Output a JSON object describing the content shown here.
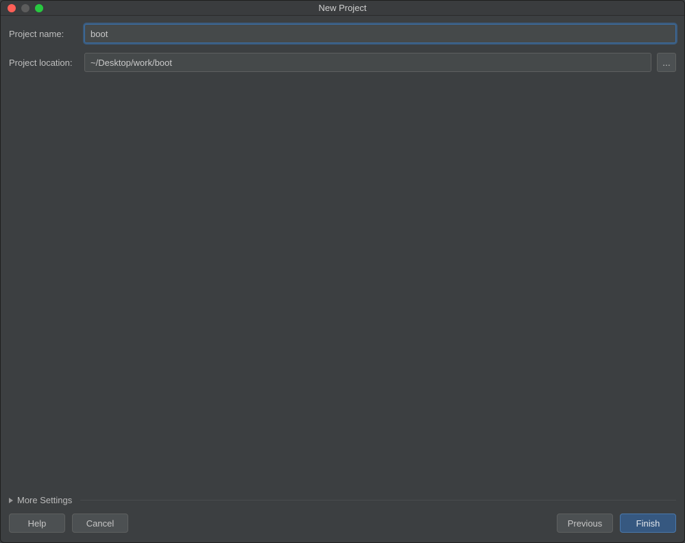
{
  "window": {
    "title": "New Project"
  },
  "form": {
    "project_name_label": "Project name:",
    "project_name_value": "boot",
    "project_location_label": "Project location:",
    "project_location_value": "~/Desktop/work/boot",
    "browse_label": "..."
  },
  "more_settings": {
    "label": "More Settings"
  },
  "buttons": {
    "help": "Help",
    "cancel": "Cancel",
    "previous": "Previous",
    "finish": "Finish"
  }
}
